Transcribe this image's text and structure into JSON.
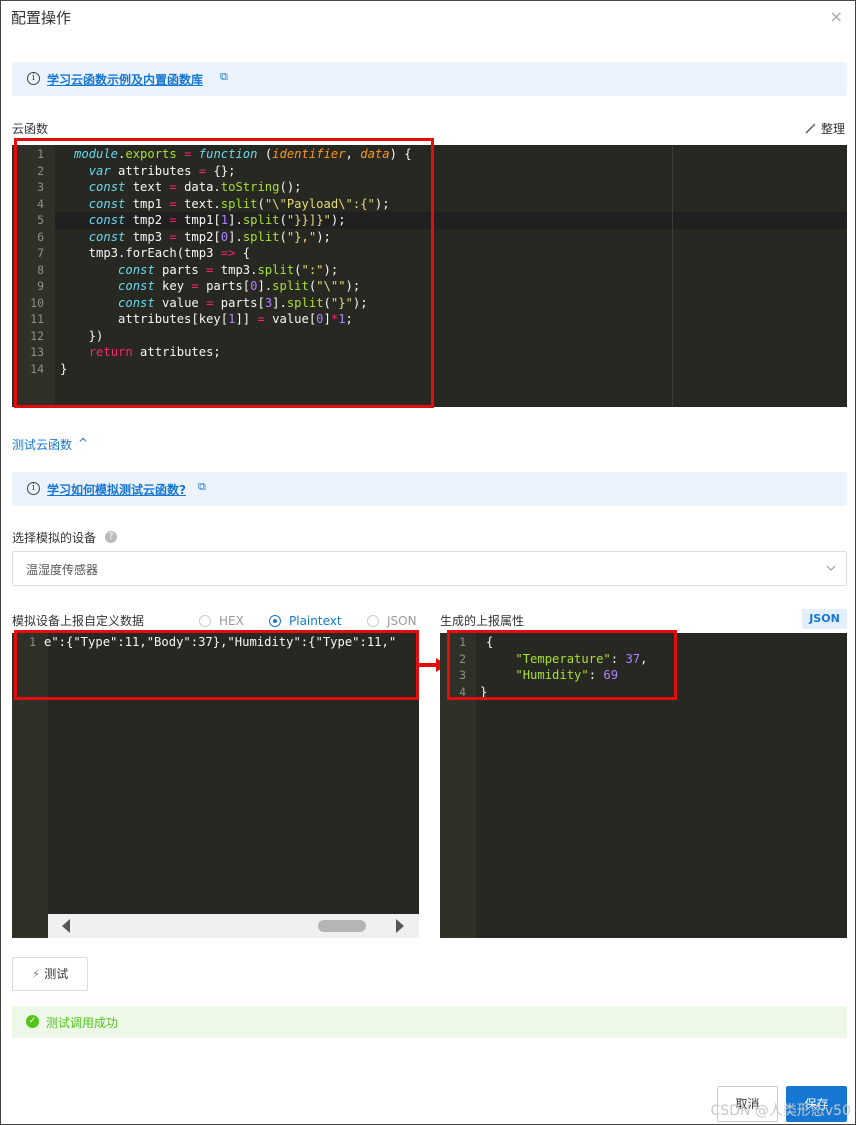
{
  "dialog": {
    "title": "配置操作",
    "close_glyph": "×"
  },
  "info1": {
    "link": "学习云函数示例及内置函数库",
    "ext_glyph": "⧉"
  },
  "cloud_fn": {
    "label": "云函数",
    "format_label": "整理",
    "lines": [
      "1",
      "2",
      "3",
      "4",
      "5",
      "6",
      "7",
      "8",
      "9",
      "10",
      "11",
      "12",
      "13",
      "14"
    ]
  },
  "test_toggle": {
    "label": "测试云函数",
    "chevron": "^"
  },
  "info2": {
    "link": "学习如何模拟测试云函数?",
    "ext_glyph": "⧉"
  },
  "device": {
    "label": "选择模拟的设备",
    "help": "?",
    "value": "温湿度传感器"
  },
  "sim": {
    "label": "模拟设备上报自定义数据",
    "formats": [
      "HEX",
      "Plaintext",
      "JSON"
    ],
    "selected_format": "Plaintext",
    "line_no": "1",
    "content": "e\":{\"Type\":11,\"Body\":37},\"Humidity\":{\"Type\":11,\""
  },
  "output": {
    "label": "生成的上报属性",
    "badge": "JSON",
    "lines": [
      "1",
      "2",
      "3",
      "4"
    ],
    "temp_key": "\"Temperature\"",
    "temp_val": "37",
    "hum_key": "\"Humidity\"",
    "hum_val": "69"
  },
  "test_button": {
    "label": "测试"
  },
  "result": {
    "message": "测试调用成功"
  },
  "footer": {
    "cancel": "取消",
    "save": "保存"
  },
  "watermark": "CSDN @人类形态v50",
  "colors": {
    "accent": "#1677d2",
    "success": "#52c41a",
    "editor_bg": "#272822",
    "highlight": "#e30d0d"
  }
}
